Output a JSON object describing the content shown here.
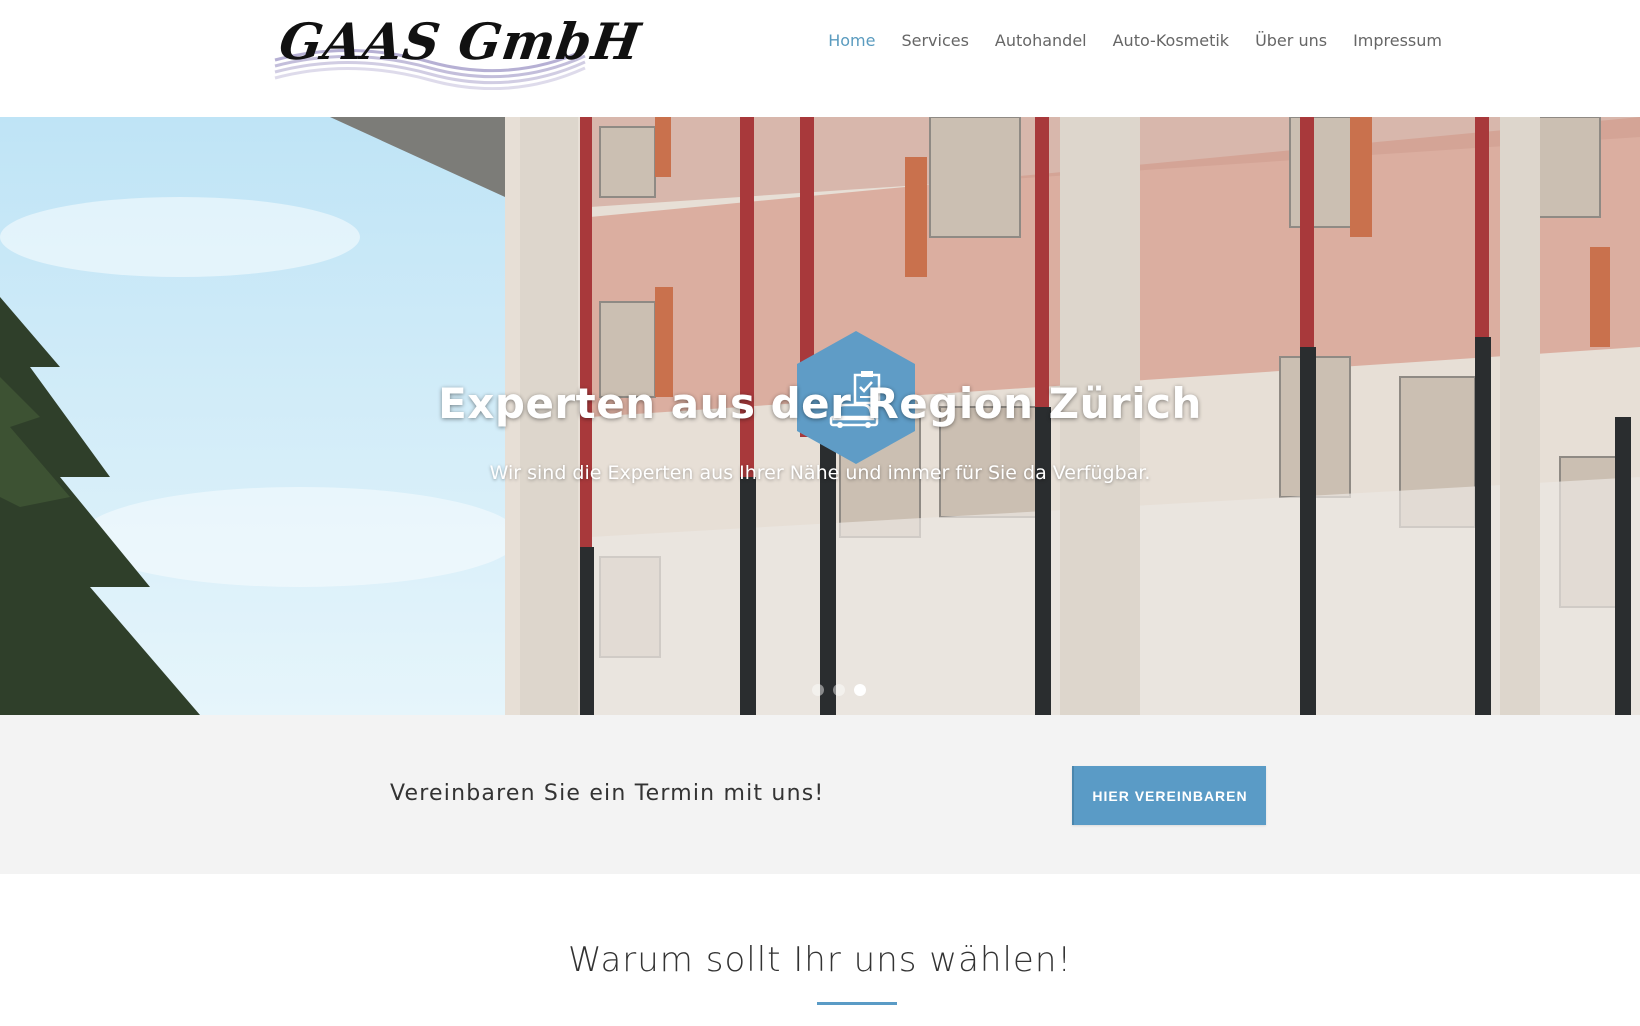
{
  "header": {
    "logo_text": "GAAS GmbH",
    "nav": [
      {
        "label": "Home",
        "active": true
      },
      {
        "label": "Services",
        "active": false
      },
      {
        "label": "Autohandel",
        "active": false
      },
      {
        "label": "Auto-Kosmetik",
        "active": false
      },
      {
        "label": "Über uns",
        "active": false
      },
      {
        "label": "Impressum",
        "active": false
      }
    ]
  },
  "hero": {
    "icon": "car-checklist-icon",
    "title": "Experten aus der Region Zürich",
    "subtitle": "Wir sind die Experten aus Ihrer Nähe und immer für Sie da Verfügbar.",
    "slides_total": 3,
    "active_slide": 3
  },
  "cta": {
    "text": "Vereinbaren Sie ein Termin mit uns!",
    "button_label": "HIER VEREINBAREN"
  },
  "why": {
    "title": "Warum sollt Ihr uns wählen!"
  },
  "colors": {
    "accent": "#5a9bc6",
    "nav_active": "#5a9bbf",
    "cta_bg": "#f3f3f3"
  }
}
